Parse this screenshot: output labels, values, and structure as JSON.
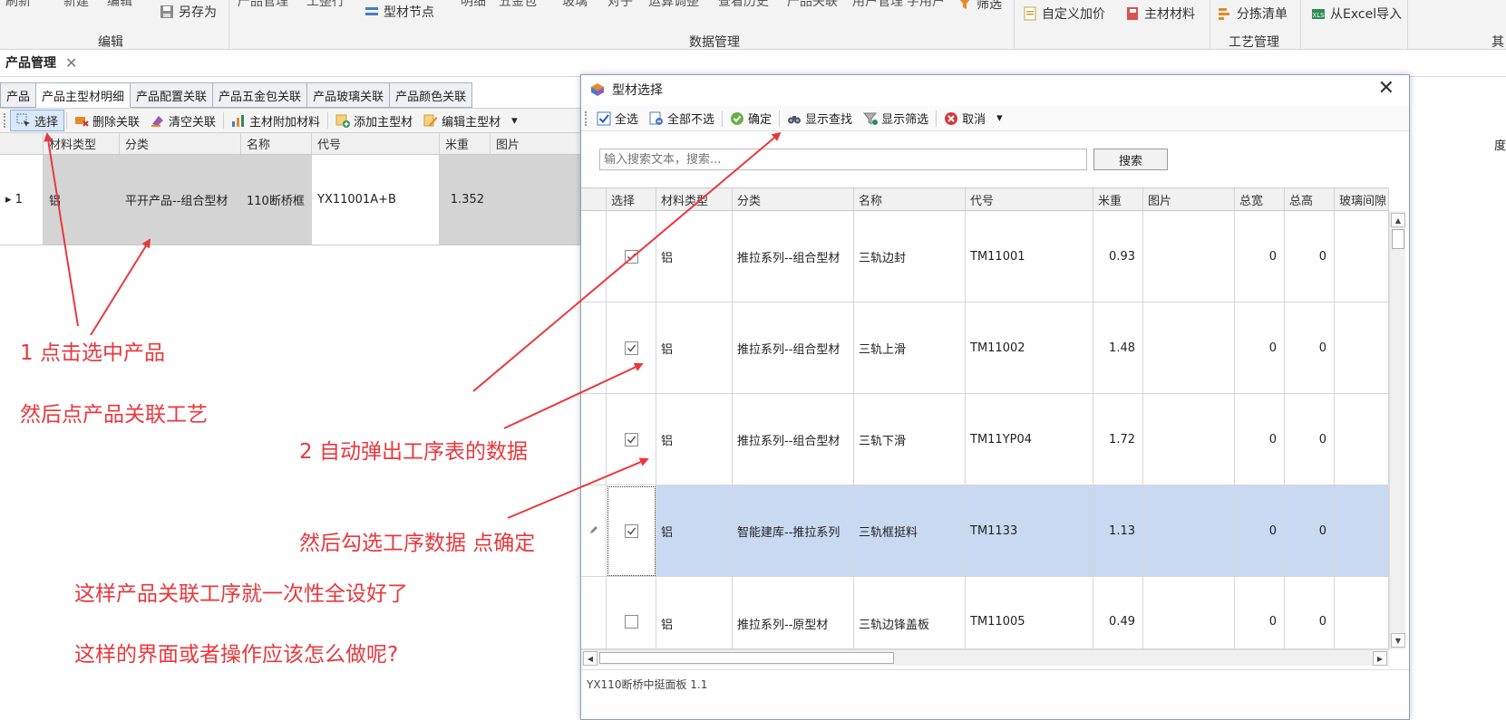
{
  "ribbon": {
    "top_cut": [
      "刷新",
      "新建",
      "编辑",
      "产品管理",
      "工整行",
      "明细",
      "五金包",
      "玻璃",
      "玻璃",
      "对子",
      "运算调整",
      "查看历史",
      "产品关联",
      "用户管理",
      "字用户"
    ],
    "save_as": "另存为",
    "profile_node": "型材节点",
    "filter": "筛选",
    "custom_price": "自定义加价",
    "main_material": "主材材料",
    "sort_list": "分拣清单",
    "import_excel": "从Excel导入",
    "group_edit": "编辑",
    "group_data": "数据管理",
    "group_process": "工艺管理",
    "group_more": "其"
  },
  "doc_tab": {
    "label": "产品管理",
    "close": "✕"
  },
  "subtabs": [
    "产品",
    "产品主型材明细",
    "产品配置关联",
    "产品五金包关联",
    "产品玻璃关联",
    "产品颜色关联"
  ],
  "toolbar": {
    "select": "选择",
    "delete_link": "删除关联",
    "clear_link": "清空关联",
    "main_addon": "主材附加材料",
    "add_main": "添加主型材",
    "edit_main": "编辑主型材",
    "more": "▾"
  },
  "main_grid": {
    "columns": [
      "材料类型",
      "分类",
      "名称",
      "代号",
      "米重",
      "图片"
    ],
    "row": {
      "indicator": "▸ 1",
      "material": "铝",
      "category": "平开产品--组合型材",
      "name": "110断桥框",
      "code": "YX11001A+B",
      "weight": "1.352",
      "image": ""
    },
    "right_edge": "度"
  },
  "annotations": {
    "a1": "1 点击选中产品",
    "a2": "然后点产品关联工艺",
    "a3": "2 自动弹出工序表的数据",
    "a4": "然后勾选工序数据  点确定",
    "a5": "这样产品关联工序就一次性全设好了",
    "a6": "这样的界面或者操作应该怎么做呢?"
  },
  "dialog": {
    "title": "型材选择",
    "close": "✕",
    "toolbar": {
      "select_all": "全选",
      "deselect_all": "全部不选",
      "confirm": "确定",
      "show_find": "显示查找",
      "show_filter": "显示筛选",
      "cancel": "取消",
      "more": "▾"
    },
    "search": {
      "placeholder": "输入搜索文本，搜索...",
      "button": "搜索"
    },
    "columns": [
      "选择",
      "材料类型",
      "分类",
      "名称",
      "代号",
      "米重",
      "图片",
      "总宽",
      "总高",
      "玻璃间隙"
    ],
    "rows": [
      {
        "checked": true,
        "material": "铝",
        "category": "推拉系列--组合型材",
        "name": "三轨边封",
        "code": "TM11001",
        "weight": "0.93",
        "width": "0",
        "height": "0"
      },
      {
        "checked": true,
        "material": "铝",
        "category": "推拉系列--组合型材",
        "name": "三轨上滑",
        "code": "TM11002",
        "weight": "1.48",
        "width": "0",
        "height": "0"
      },
      {
        "checked": true,
        "material": "铝",
        "category": "推拉系列--组合型材",
        "name": "三轨下滑",
        "code": "TM11YP04",
        "weight": "1.72",
        "width": "0",
        "height": "0"
      },
      {
        "checked": true,
        "material": "铝",
        "category": "智能建库--推拉系列",
        "name": "三轨框挺料",
        "code": "TM1133",
        "weight": "1.13",
        "width": "0",
        "height": "0"
      },
      {
        "checked": false,
        "material": "铝",
        "category": "推拉系列--原型材",
        "name": "三轨边锋盖板",
        "code": "TM11005",
        "weight": "0.49",
        "width": "0",
        "height": "0"
      }
    ],
    "footer_cut": "YX110断桥中挺面板 1.1"
  },
  "colors": {
    "annotation": "#e8383d",
    "highlight_row": "#c9d9f2",
    "selected_product": "#d4d4d4"
  }
}
